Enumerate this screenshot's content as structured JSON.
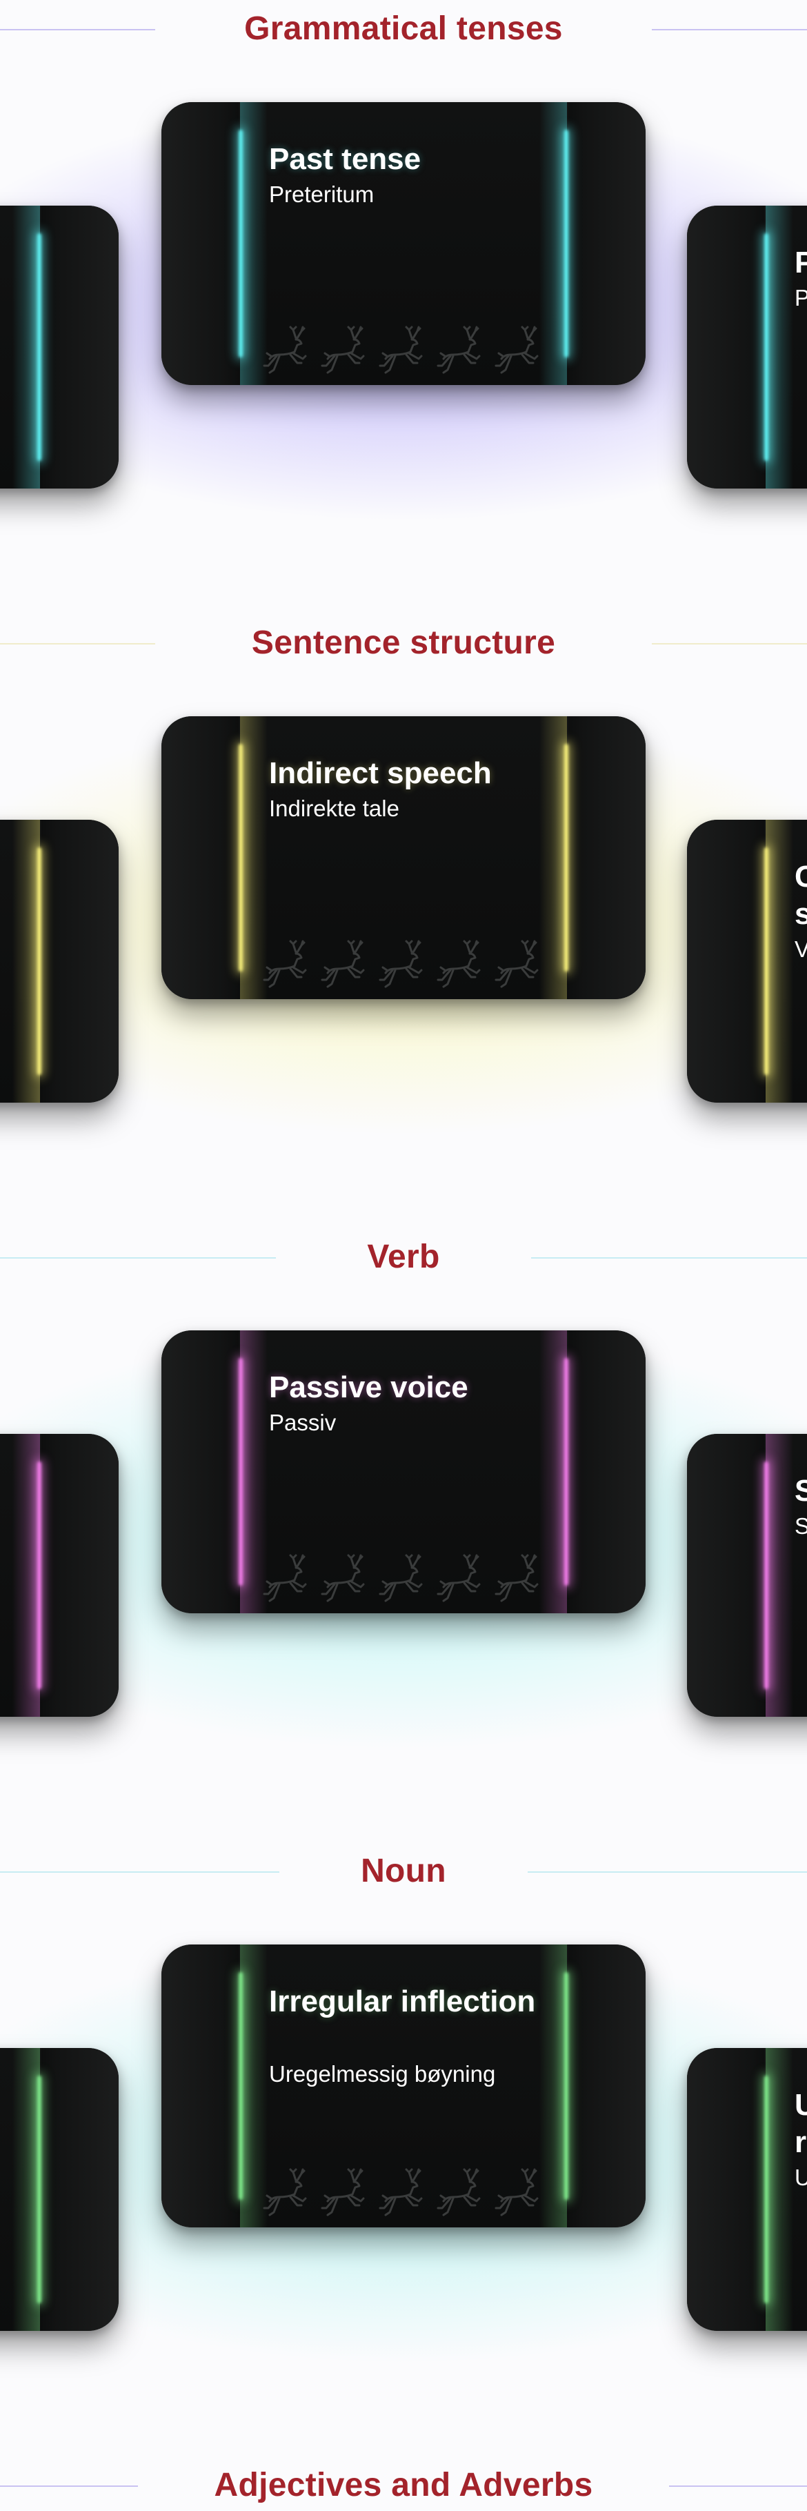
{
  "sections": [
    {
      "title": "Grammatical tenses",
      "bg_color": "#b9b0f8",
      "line_color": "#a99be8",
      "accent": "#5ff0f2",
      "card": {
        "title": "Past tense",
        "subtitle": "Preteritum"
      },
      "right_peek": {
        "title": "P",
        "subtitle": "P"
      }
    },
    {
      "title": "Sentence structure",
      "bg_color": "#f8f6b0",
      "line_color": "#eeeab0",
      "accent": "#f7ef7a",
      "card": {
        "title": "Indirect speech",
        "subtitle": "Indirekte tale"
      },
      "right_peek": {
        "title": "C\ns",
        "subtitle": "V"
      }
    },
    {
      "title": "Verb",
      "bg_color": "#b7f4f1",
      "line_color": "#aee8f1",
      "accent": "#f07ce8",
      "card": {
        "title": "Passive voice",
        "subtitle": "Passiv"
      },
      "right_peek": {
        "title": "S",
        "subtitle": "S"
      }
    },
    {
      "title": "Noun",
      "bg_color": "#b3f1f0",
      "line_color": "#aee8f1",
      "accent": "#7fe88a",
      "card": {
        "title": "Irregular inflection",
        "subtitle": "Uregelmessig bøyning"
      },
      "right_peek": {
        "title": "U\nr",
        "subtitle": "U"
      }
    },
    {
      "title": "Adjectives and Adverbs",
      "bg_color": "#f5f5fa",
      "line_color": "#b5b0e8",
      "accent": "#9f9f9f",
      "card": null,
      "right_peek": null
    }
  ],
  "icons": {
    "deer": "leaping-deer-icon"
  }
}
